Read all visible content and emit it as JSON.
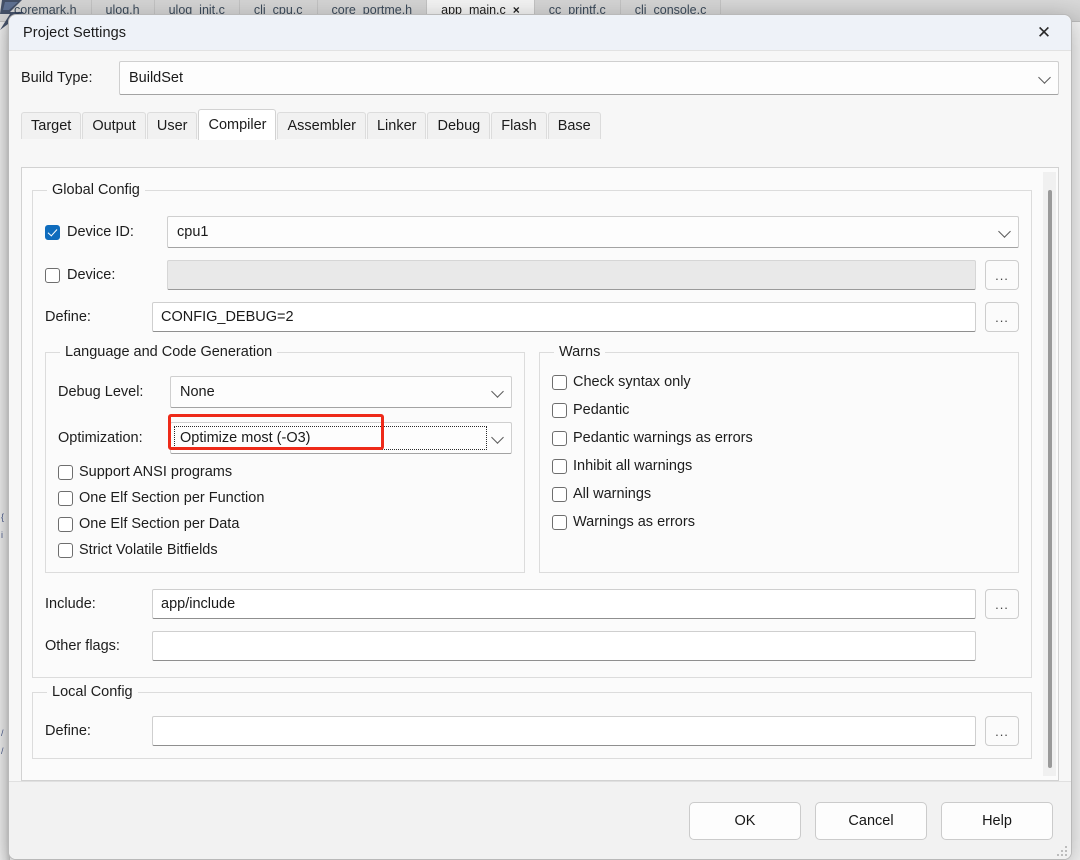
{
  "background": {
    "editor_tabs": [
      {
        "label": "coremark.h",
        "active": false,
        "closable": false
      },
      {
        "label": "ulog.h",
        "active": false,
        "closable": false
      },
      {
        "label": "ulog_init.c",
        "active": false,
        "closable": false
      },
      {
        "label": "cli_cpu.c",
        "active": false,
        "closable": false
      },
      {
        "label": "core_portme.h",
        "active": false,
        "closable": false
      },
      {
        "label": "app_main.c",
        "active": true,
        "closable": true,
        "close_glyph": "×"
      },
      {
        "label": "cc_printf.c",
        "active": false,
        "closable": false
      },
      {
        "label": "cli_console.c",
        "active": false,
        "closable": false
      }
    ],
    "gutter_marks": [
      "{",
      "i",
      "/",
      "/"
    ]
  },
  "dialog": {
    "title": "Project Settings",
    "close_glyph": "✕",
    "build_type": {
      "label": "Build Type:",
      "value": "BuildSet"
    },
    "tabs": [
      {
        "label": "Target",
        "active": false
      },
      {
        "label": "Output",
        "active": false
      },
      {
        "label": "User",
        "active": false
      },
      {
        "label": "Compiler",
        "active": true
      },
      {
        "label": "Assembler",
        "active": false
      },
      {
        "label": "Linker",
        "active": false
      },
      {
        "label": "Debug",
        "active": false
      },
      {
        "label": "Flash",
        "active": false
      },
      {
        "label": "Base",
        "active": false
      }
    ],
    "global_config": {
      "legend": "Global Config",
      "device_id": {
        "label": "Device ID:",
        "checked": true,
        "value": "cpu1"
      },
      "device": {
        "label": "Device:",
        "checked": false,
        "value": "",
        "disabled": true,
        "browse_label": "..."
      },
      "define": {
        "label": "Define:",
        "value": "CONFIG_DEBUG=2",
        "browse_label": "..."
      },
      "language_group": {
        "legend": "Language and Code Generation",
        "debug_level": {
          "label": "Debug Level:",
          "value": "None"
        },
        "optimization": {
          "label": "Optimization:",
          "value": "Optimize most (-O3)",
          "highlighted": true,
          "highlight_color": "#ee2a19"
        },
        "checkboxes": [
          {
            "label": "Support ANSI programs",
            "checked": false
          },
          {
            "label": "One Elf Section per Function",
            "checked": false
          },
          {
            "label": "One Elf Section per Data",
            "checked": false
          },
          {
            "label": "Strict Volatile Bitfields",
            "checked": false
          }
        ]
      },
      "warns_group": {
        "legend": "Warns",
        "checkboxes": [
          {
            "label": "Check syntax only",
            "checked": false
          },
          {
            "label": "Pedantic",
            "checked": false
          },
          {
            "label": "Pedantic warnings as errors",
            "checked": false
          },
          {
            "label": "Inhibit all warnings",
            "checked": false
          },
          {
            "label": "All warnings",
            "checked": false
          },
          {
            "label": "Warnings as errors",
            "checked": false
          }
        ]
      },
      "include": {
        "label": "Include:",
        "value": "app/include",
        "browse_label": "..."
      },
      "other_flags": {
        "label": "Other flags:",
        "value": "",
        "browse_label": "..."
      }
    },
    "local_config": {
      "legend": "Local Config",
      "define": {
        "label": "Define:",
        "value": "",
        "browse_label": "..."
      }
    },
    "footer": {
      "ok_label": "OK",
      "cancel_label": "Cancel",
      "help_label": "Help"
    },
    "accent_checkbox_color": "#0f6cbd"
  }
}
